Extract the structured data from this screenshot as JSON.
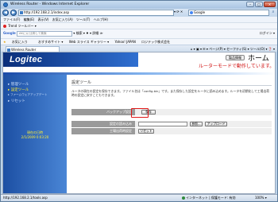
{
  "window": {
    "title": "Wireless Router - Windows Internet Explorer",
    "minimize": "–",
    "maximize": "□",
    "close": "✕"
  },
  "address_bar": {
    "back": "◀",
    "forward": "▶",
    "url": "http://192.168.2.1/index.asp",
    "tools": "▾ ⟳ ✕",
    "search_placeholder": "Google",
    "search_button": "⌕"
  },
  "menu": [
    "ファイル(F)",
    "編集(E)",
    "表示(V)",
    "お気に入り(A)",
    "ツール(T)",
    "ヘルプ(H)"
  ],
  "trend_toolbar": {
    "label": "Trend ツールバー ▾"
  },
  "google_toolbar": {
    "logo": "Google",
    "input_placeholder": "AKに以 比例して検索",
    "buttons": "▾ 検索 ▾ ♦ ▾ 詳細 ≫",
    "signin": "ログイン ▾"
  },
  "favorites_bar": {
    "favorites": "お気に入り",
    "items": [
      "おすすめサイト ▾",
      "Web スライス ギャラリー ▾",
      "Yahoo! JAPAN",
      "ロジテック株式会社"
    ]
  },
  "tabs": [
    {
      "label": "Wireless Router"
    }
  ],
  "command_bar": "⌂ ▾ ▣ ▾ ✉ ▾ ページ(P) ▾ セーフティ(S) ▾ ツール(O) ▾ ❓ ▾",
  "header": {
    "logo": "Logitec",
    "model_badge": "製品情報",
    "home": "ホーム",
    "router_mode": "ルーターモードで動作しています。"
  },
  "sidebar": {
    "items": [
      {
        "label": "▸ 管理ツール"
      },
      {
        "label": "▸ 設定ツール"
      },
      {
        "label": "▸ ファームウェアアップデート"
      },
      {
        "label": "▸ リセット"
      }
    ],
    "status_title": "現在の日時",
    "status_time": "2/1/2009 0:03:20"
  },
  "main": {
    "title": "設定ツール",
    "description": "ルータの現在の設定を保存できます。ファイル名は「config.bin」です。また保存した設定をルータに読み込めます。ルータを初期化して工場出荷時の設定に戻すこともできます。",
    "rows": [
      {
        "label": "バックアップ設定",
        "button": "保存"
      },
      {
        "label": "設定の読み込み",
        "button": "参照...",
        "button2": "アップロード"
      },
      {
        "label": "工場出荷時設定",
        "button": "リセット"
      }
    ]
  },
  "status_bar": {
    "url": "http://192.168.2.1/tools.asp",
    "zone": "インターネット | 保護モード: 有効",
    "zoom": "100% ▾"
  },
  "colors": {
    "accent_red": "#d01010",
    "sidebar_blue": "#1c4fa3",
    "sidebar_active": "#ffee33"
  }
}
